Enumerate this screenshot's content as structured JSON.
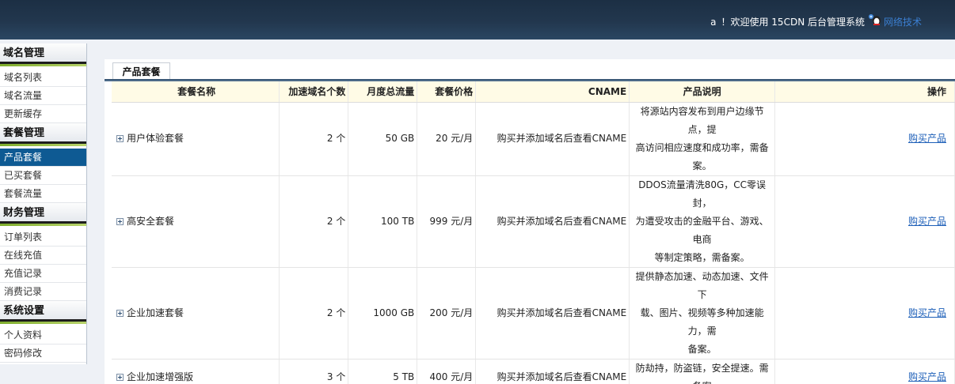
{
  "header": {
    "user": "a",
    "welcome": "！欢迎使用 15CDN 后台管理系统",
    "tech_link": "网络技术"
  },
  "sidebar": [
    {
      "title": "域名管理",
      "items": [
        {
          "label": "域名列表"
        },
        {
          "label": "域名流量"
        },
        {
          "label": "更新缓存"
        }
      ]
    },
    {
      "title": "套餐管理",
      "items": [
        {
          "label": "产品套餐",
          "active": true
        },
        {
          "label": "已买套餐"
        },
        {
          "label": "套餐流量"
        }
      ]
    },
    {
      "title": "财务管理",
      "items": [
        {
          "label": "订单列表"
        },
        {
          "label": "在线充值"
        },
        {
          "label": "充值记录"
        },
        {
          "label": "消费记录"
        }
      ]
    },
    {
      "title": "系统设置",
      "items": [
        {
          "label": "个人资料"
        },
        {
          "label": "密码修改"
        }
      ]
    }
  ],
  "tab": {
    "label": "产品套餐"
  },
  "table": {
    "headers": {
      "name": "套餐名称",
      "domains": "加速域名个数",
      "traffic": "月度总流量",
      "price": "套餐价格",
      "cname": "CNAME",
      "desc": "产品说明",
      "op": "操作"
    },
    "rows": [
      {
        "name": "用户体验套餐",
        "domains": "2 个",
        "traffic": "50 GB",
        "price": "20 元/月",
        "cname": "购买并添加域名后查看CNAME",
        "desc": [
          "将源站内容发布到用户边缘节点，提",
          "高访问相应速度和成功率，需备案。"
        ],
        "op": "购买产品"
      },
      {
        "name": "高安全套餐",
        "domains": "2 个",
        "traffic": "100 TB",
        "price": "999 元/月",
        "cname": "购买并添加域名后查看CNAME",
        "desc": [
          "DDOS流量清洗80G，CC零误封，",
          "为遭受攻击的金融平台、游戏、电商",
          "等制定策略，需备案。"
        ],
        "op": "购买产品"
      },
      {
        "name": "企业加速套餐",
        "domains": "2 个",
        "traffic": "1000 GB",
        "price": "200 元/月",
        "cname": "购买并添加域名后查看CNAME",
        "desc": [
          "提供静态加速、动态加速、文件下",
          "载、图片、视频等多种加速能力，需",
          "备案。"
        ],
        "op": "购买产品"
      },
      {
        "name": "企业加速增强版",
        "domains": "3 个",
        "traffic": "5 TB",
        "price": "400 元/月",
        "cname": "购买并添加域名后查看CNAME",
        "desc": [
          "防劫持，防盗链，安全提速。需备案"
        ],
        "op": "购买产品"
      }
    ]
  }
}
